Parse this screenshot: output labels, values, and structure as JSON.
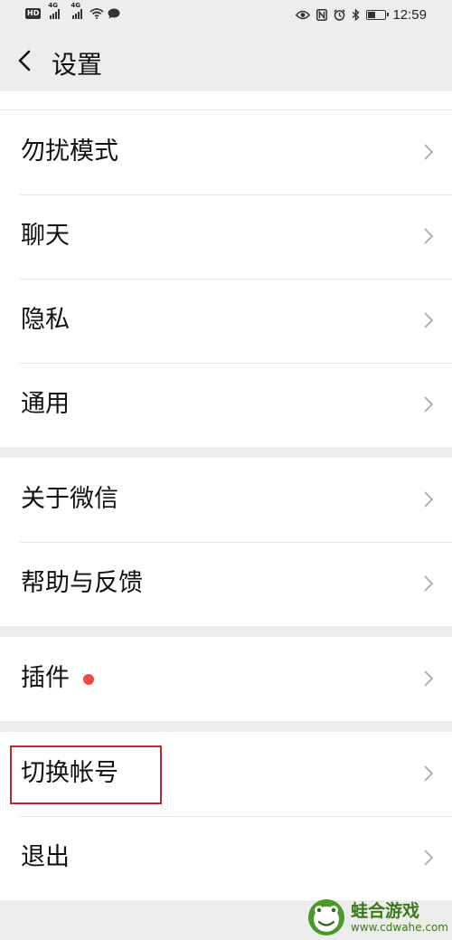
{
  "status_bar": {
    "hd": "HD",
    "net1": "4G",
    "net2": "4G",
    "time": "12:59",
    "battery_level": 0.45,
    "icons": [
      "hd-icon",
      "signal-icon",
      "signal-icon",
      "wifi-icon",
      "message-icon",
      "eye-icon",
      "nfc-icon",
      "alarm-icon",
      "bluetooth-icon",
      "battery-icon"
    ]
  },
  "header": {
    "title": "设置"
  },
  "groups": [
    {
      "items": [
        {
          "label": "勿扰模式"
        },
        {
          "label": "聊天"
        },
        {
          "label": "隐私"
        },
        {
          "label": "通用"
        }
      ]
    },
    {
      "items": [
        {
          "label": "关于微信"
        },
        {
          "label": "帮助与反馈"
        }
      ]
    },
    {
      "items": [
        {
          "label": "插件",
          "has_red_dot": true
        }
      ]
    },
    {
      "items": [
        {
          "label": "切换帐号",
          "highlighted": true
        },
        {
          "label": "退出"
        }
      ]
    }
  ],
  "colors": {
    "background": "#ececec",
    "row": "#ffffff",
    "red_dot": "#f04848",
    "highlight_box": "#c0262b",
    "watermark": "#3a7a1a"
  },
  "watermark": {
    "name": "蛙合游戏",
    "url": "www.cdwahe.com"
  }
}
